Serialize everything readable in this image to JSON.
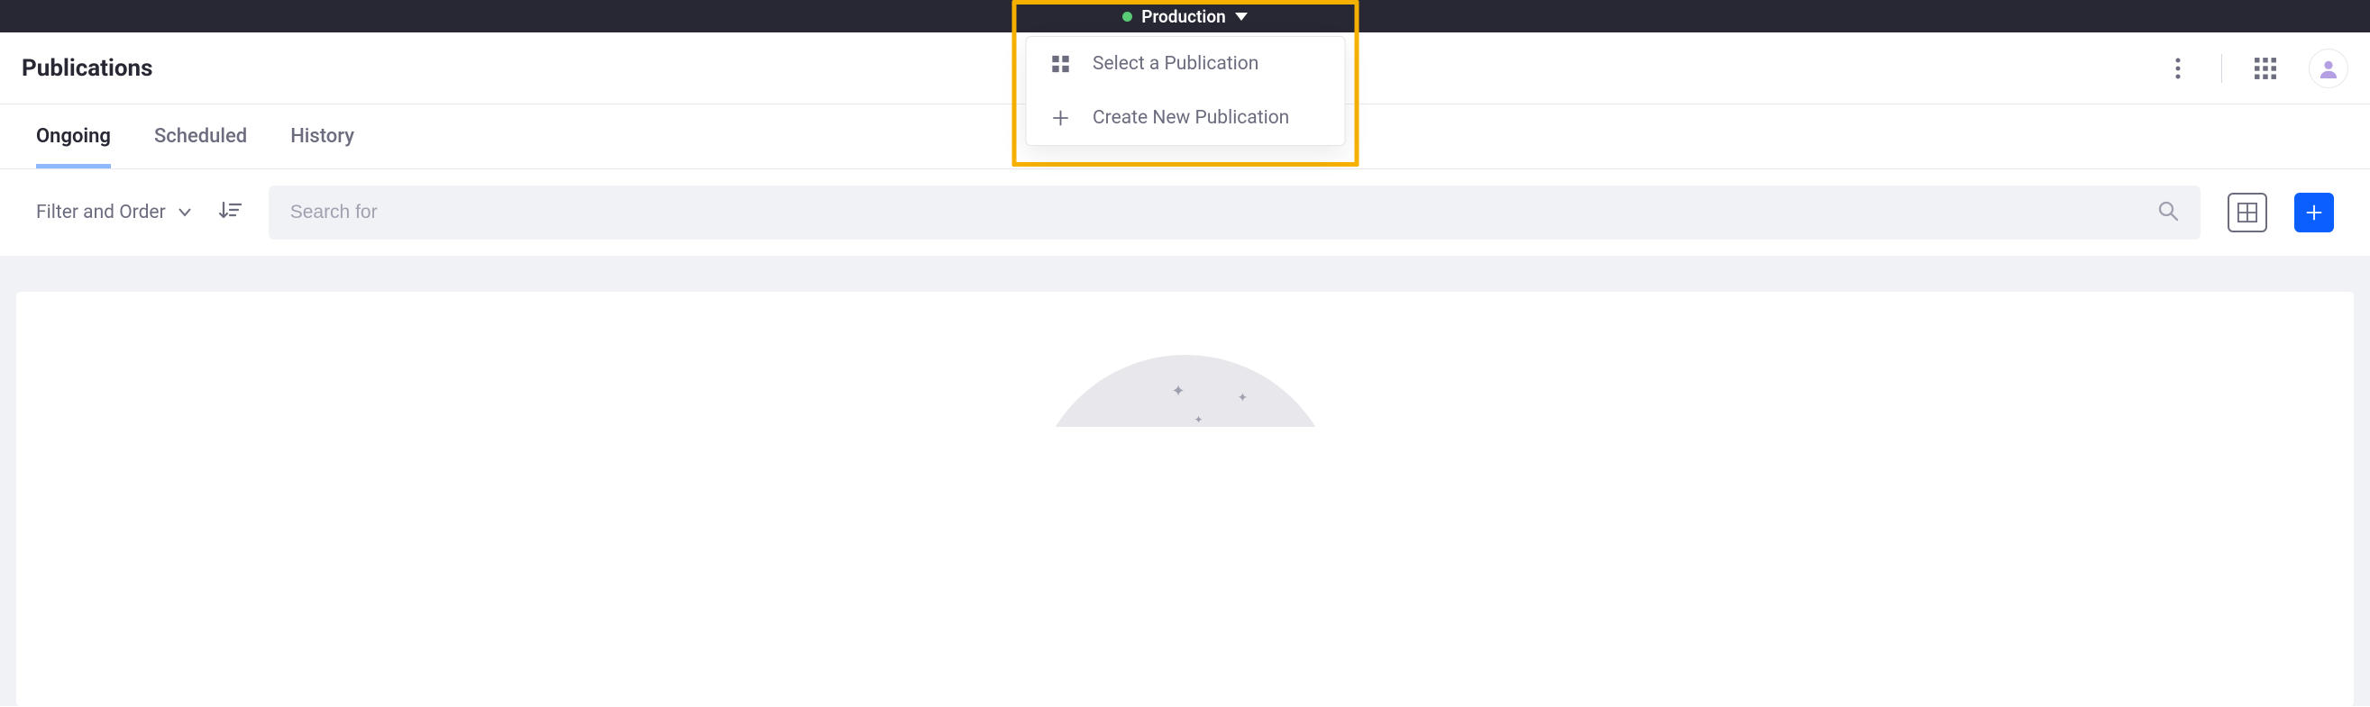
{
  "topbar": {
    "environment_label": "Production",
    "status_color": "#5aca75"
  },
  "dropdown": {
    "select_label": "Select a Publication",
    "create_label": "Create New Publication"
  },
  "header": {
    "page_title": "Publications"
  },
  "tabs": [
    {
      "label": "Ongoing",
      "active": true
    },
    {
      "label": "Scheduled",
      "active": false
    },
    {
      "label": "History",
      "active": false
    }
  ],
  "toolbar": {
    "filter_order_label": "Filter and Order",
    "search_placeholder": "Search for"
  },
  "colors": {
    "highlight": "#f6b100",
    "primary": "#0b5fff",
    "tab_underline": "#8fb8ff"
  }
}
